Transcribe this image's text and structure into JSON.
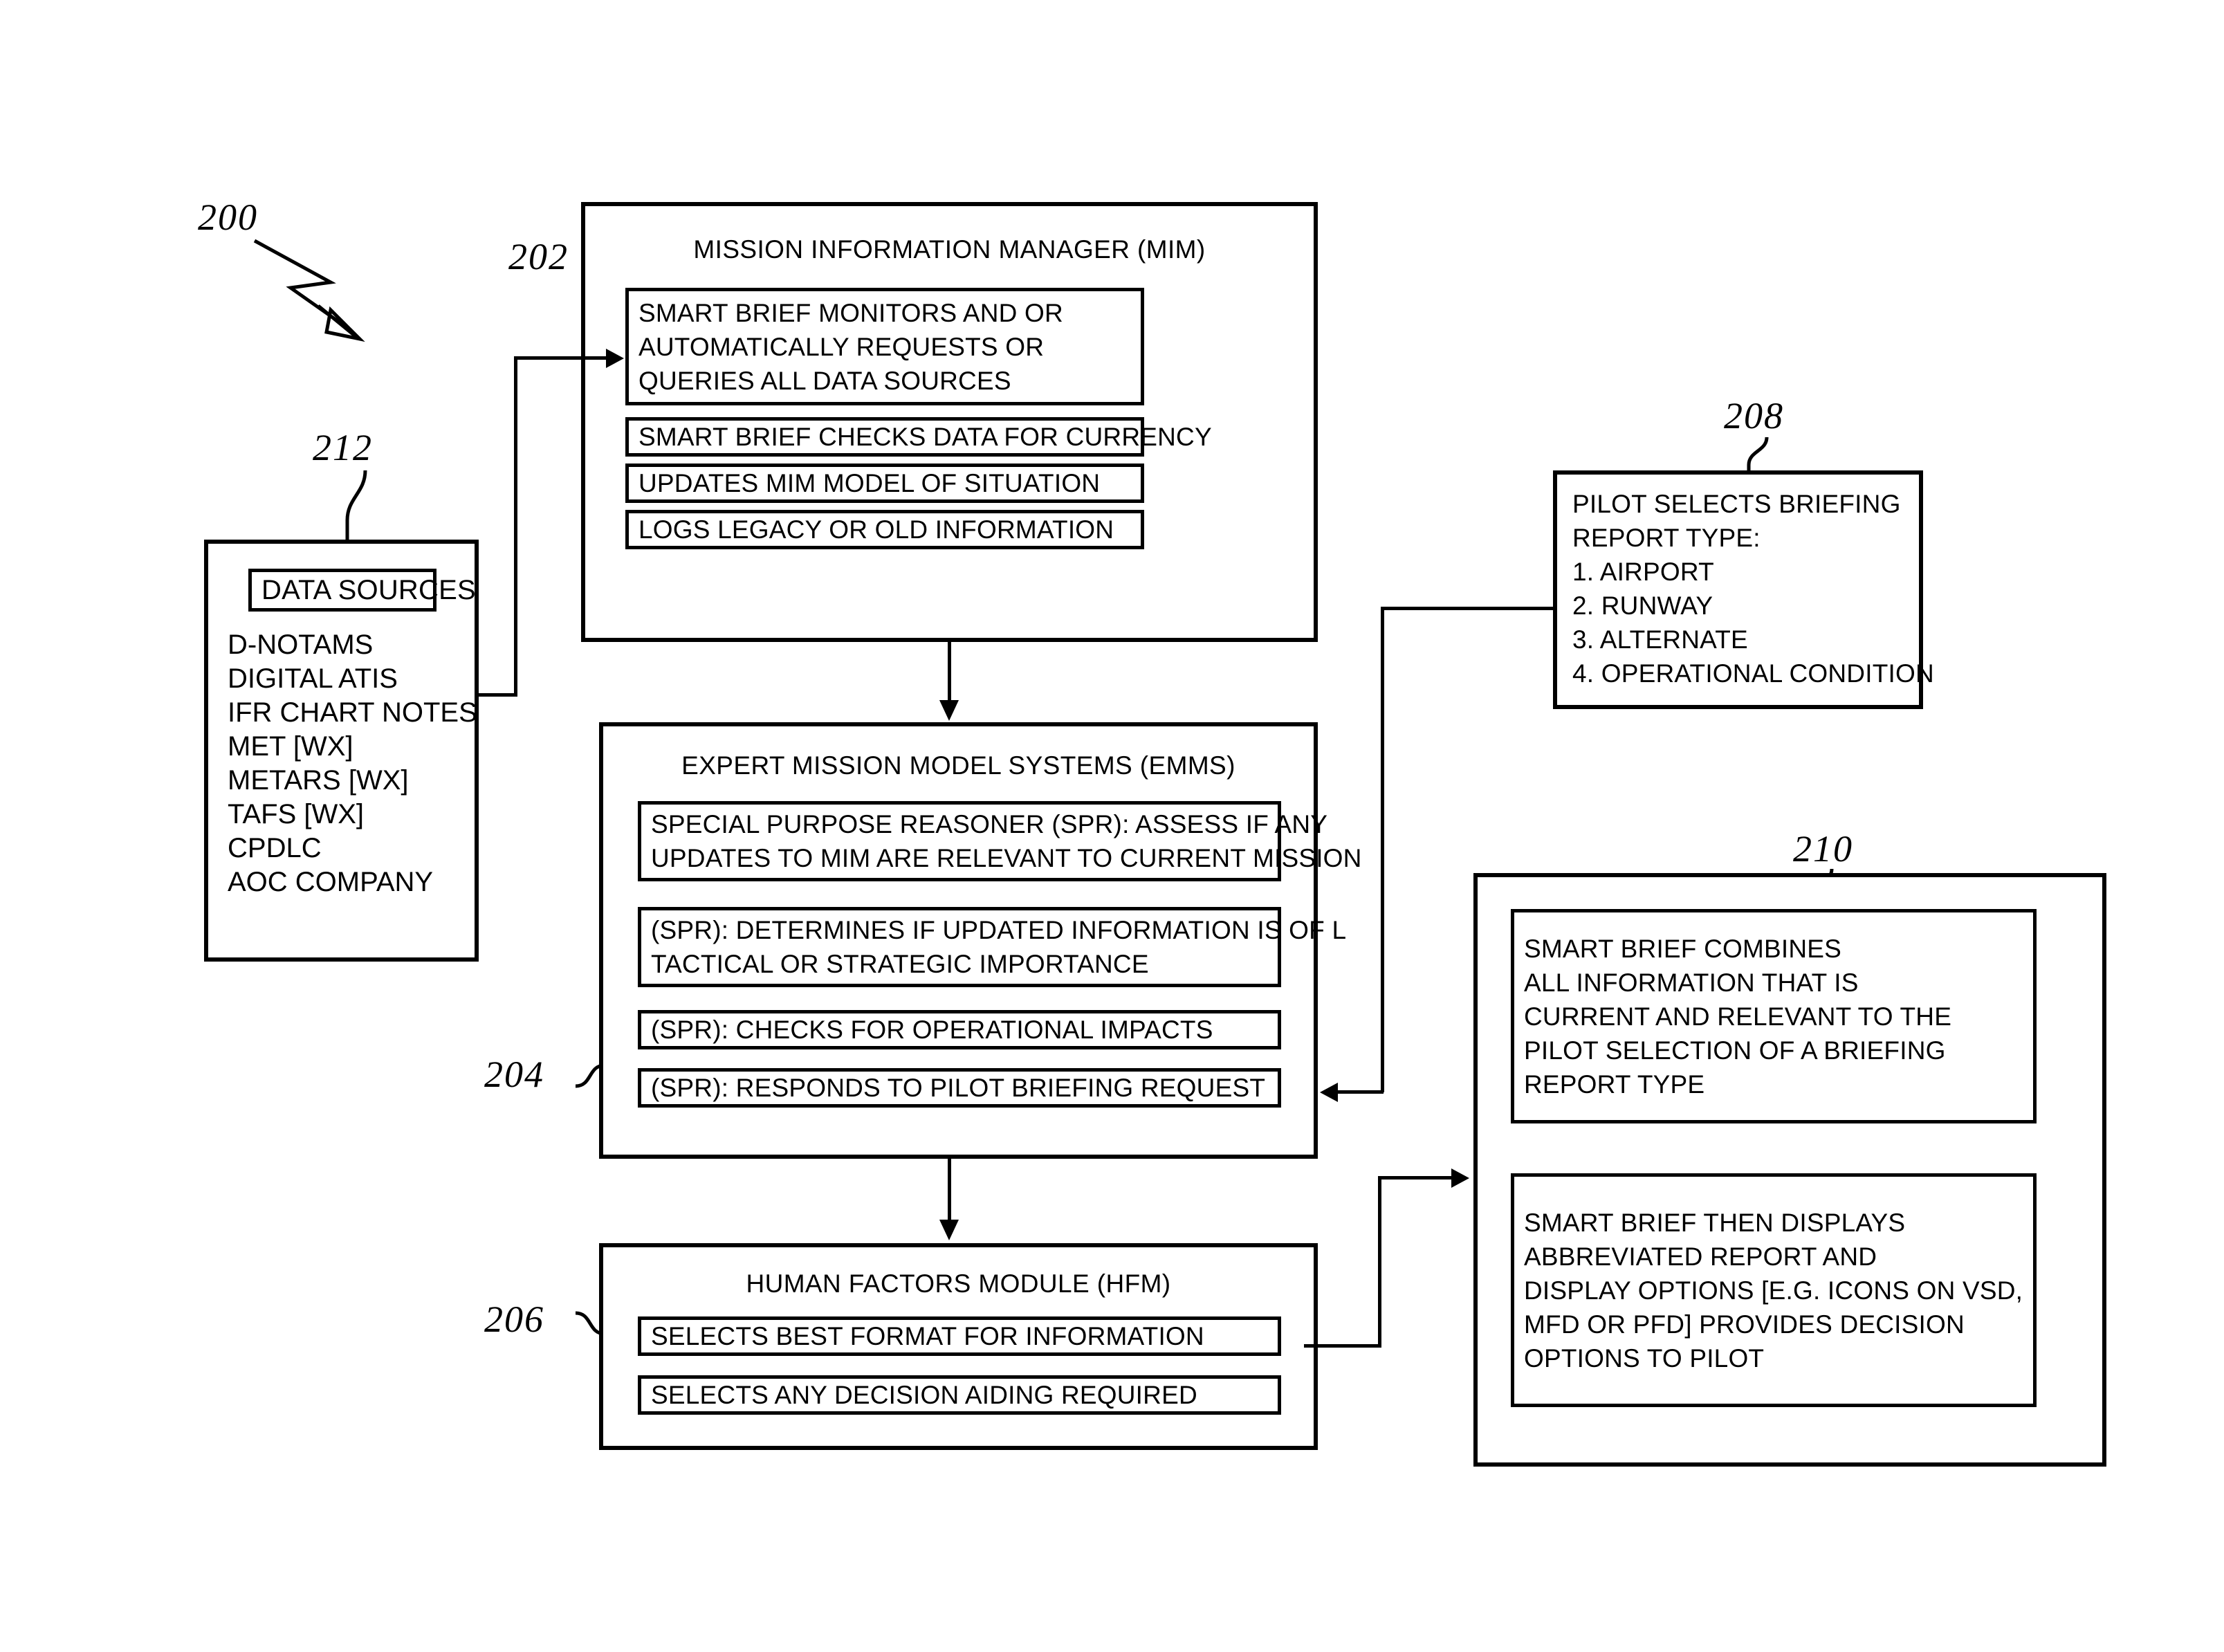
{
  "figure": {
    "number": "200",
    "type": "patent-flow-diagram"
  },
  "refs": {
    "fig": "200",
    "mim": "202",
    "emms": "204",
    "hfm": "206",
    "pilot_select": "208",
    "smart_brief": "210",
    "data_sources": "212"
  },
  "mim": {
    "title": "MISSION INFORMATION MANAGER (MIM)",
    "items": [
      {
        "lines": [
          "SMART BRIEF MONITORS AND OR",
          "AUTOMATICALLY REQUESTS OR",
          "QUERIES ALL DATA SOURCES"
        ]
      },
      {
        "lines": [
          "SMART BRIEF CHECKS DATA FOR CURRENCY"
        ]
      },
      {
        "lines": [
          "UPDATES MIM MODEL OF SITUATION"
        ]
      },
      {
        "lines": [
          "LOGS LEGACY OR OLD INFORMATION"
        ]
      }
    ]
  },
  "data_sources": {
    "heading": "DATA SOURCES",
    "items": [
      "D-NOTAMS",
      "DIGITAL ATIS",
      "IFR CHART NOTES",
      "MET [WX]",
      "METARS [WX]",
      "TAFS [WX]",
      "CPDLC",
      "AOC COMPANY"
    ]
  },
  "emms": {
    "title": "EXPERT MISSION MODEL SYSTEMS (EMMS)",
    "items": [
      {
        "lines": [
          "SPECIAL PURPOSE REASONER (SPR): ASSESS IF ANY",
          "UPDATES TO MIM ARE RELEVANT TO CURRENT MISSION"
        ]
      },
      {
        "lines": [
          "(SPR): DETERMINES IF UPDATED INFORMATION IS OF L",
          "TACTICAL OR STRATEGIC IMPORTANCE"
        ]
      },
      {
        "lines": [
          "(SPR): CHECKS FOR OPERATIONAL IMPACTS"
        ]
      },
      {
        "lines": [
          "(SPR): RESPONDS TO PILOT BRIEFING REQUEST"
        ]
      }
    ]
  },
  "hfm": {
    "title": "HUMAN FACTORS MODULE (HFM)",
    "items": [
      {
        "lines": [
          "SELECTS BEST FORMAT FOR INFORMATION"
        ]
      },
      {
        "lines": [
          "SELECTS ANY DECISION AIDING REQUIRED"
        ]
      }
    ]
  },
  "pilot_select": {
    "lines": [
      "PILOT SELECTS BRIEFING",
      "REPORT TYPE:",
      "1. AIRPORT",
      "2. RUNWAY",
      "3. ALTERNATE",
      "4. OPERATIONAL CONDITION"
    ]
  },
  "smart_brief": {
    "items": [
      {
        "lines": [
          "SMART BRIEF COMBINES",
          "ALL INFORMATION THAT IS",
          "CURRENT AND RELEVANT TO THE",
          "PILOT SELECTION OF A BRIEFING",
          "REPORT TYPE"
        ]
      },
      {
        "lines": [
          "SMART BRIEF THEN DISPLAYS",
          "ABBREVIATED REPORT AND",
          "DISPLAY OPTIONS [E.G. ICONS ON VSD,",
          "MFD OR PFD] PROVIDES DECISION",
          "OPTIONS TO PILOT"
        ]
      }
    ]
  },
  "colors": {
    "ink": "#000000",
    "paper": "#ffffff"
  }
}
